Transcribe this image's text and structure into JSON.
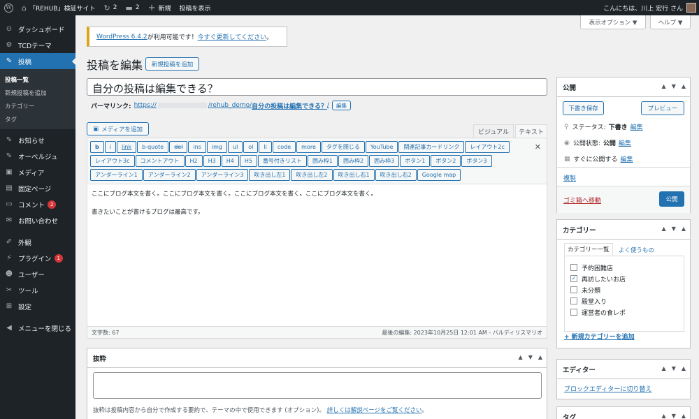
{
  "admin_bar": {
    "site_name": "「REHUB」検証サイト",
    "updates_count": "2",
    "comments_count": "2",
    "new_label": "新規",
    "view_post_label": "投稿を表示",
    "greeting": "こんにちは、川上 宏行 さん"
  },
  "sidebar": {
    "items": [
      {
        "label": "ダッシュボード",
        "icon": "dashboard-icon",
        "glyph": "⊙"
      },
      {
        "label": "TCDテーマ",
        "icon": "gear-icon",
        "glyph": "⚙"
      },
      {
        "label": "投稿",
        "icon": "pin-icon",
        "glyph": "✎"
      },
      {
        "label": "お知らせ",
        "icon": "pin-icon",
        "glyph": "✎"
      },
      {
        "label": "オーベルジュ",
        "icon": "pin-icon",
        "glyph": "✎"
      },
      {
        "label": "メディア",
        "icon": "media-icon",
        "glyph": "▣"
      },
      {
        "label": "固定ページ",
        "icon": "page-icon",
        "glyph": "▤"
      },
      {
        "label": "コメント",
        "icon": "comment-icon",
        "glyph": "▭",
        "badge": "2"
      },
      {
        "label": "お問い合わせ",
        "icon": "mail-icon",
        "glyph": "✉"
      },
      {
        "label": "外観",
        "icon": "brush-icon",
        "glyph": "✐"
      },
      {
        "label": "プラグイン",
        "icon": "plugin-icon",
        "glyph": "⚡",
        "badge": "1"
      },
      {
        "label": "ユーザー",
        "icon": "user-icon",
        "glyph": "☻"
      },
      {
        "label": "ツール",
        "icon": "wrench-icon",
        "glyph": "✂"
      },
      {
        "label": "設定",
        "icon": "settings-icon",
        "glyph": "⊞"
      },
      {
        "label": "メニューを閉じる",
        "icon": "collapse-icon",
        "glyph": "◀"
      }
    ],
    "submenu": [
      "投稿一覧",
      "新規投稿を追加",
      "カテゴリー",
      "タグ"
    ]
  },
  "top": {
    "screen_options": "表示オプション ▼",
    "help": "ヘルプ ▼"
  },
  "notice": {
    "link_version": "WordPress 6.4.2",
    "middle": " が利用可能です！",
    "link_update": "今すぐ更新してください",
    "end": "。"
  },
  "page": {
    "heading": "投稿を編集",
    "add_new": "新規投稿を追加"
  },
  "post": {
    "title": "自分の投稿は編集できる？",
    "permalink_label": "パーマリンク:",
    "permalink_base": "https://",
    "permalink_path": "/rehub_demo/",
    "permalink_slug": "自分の投稿は編集できる？",
    "permalink_end": "/",
    "edit_btn": "編集"
  },
  "editor": {
    "add_media": "メディアを追加",
    "tab_visual": "ビジュアル",
    "tab_text": "テキスト",
    "buttons": [
      "b",
      "i",
      "link",
      "b-quote",
      "del",
      "ins",
      "img",
      "ul",
      "ol",
      "li",
      "code",
      "more",
      "タグを閉じる",
      "YouTube",
      "関連記事カードリンク",
      "レイアウト2c",
      "レイアウト3c",
      "コメントアウト",
      "H2",
      "H3",
      "H4",
      "H5",
      "番号付きリスト",
      "囲み枠1",
      "囲み枠2",
      "囲み枠3",
      "ボタン1",
      "ボタン2",
      "ボタン3",
      "アンダーライン1",
      "アンダーライン2",
      "アンダーライン3",
      "吹き出し左1",
      "吹き出し左2",
      "吹き出し右1",
      "吹き出し右2",
      "Google map"
    ],
    "line1": "ここにブログ本文を書く。ここにブログ本文を書く。ここにブログ本文を書く。ここにブログ本文を書く。",
    "line2": "書きたいことが書けるブログは最高です。",
    "word_count": "文字数: 67",
    "last_edit": "最後の編集: 2023年10月25日 12:01 AM - バルディリスマリオ"
  },
  "excerpt": {
    "title": "抜粋",
    "help_text": "抜粋は投稿内容から自分で作成する要約で、テーマの中で使用できます (オプション)。",
    "help_link": "詳しくは解説ページをご覧ください",
    "help_end": "。"
  },
  "publish": {
    "title": "公開",
    "save_draft": "下書き保存",
    "preview": "プレビュー",
    "status_label": "ステータス:",
    "status_value": "下書き",
    "visibility_label": "公開状態:",
    "visibility_value": "公開",
    "schedule_text": "すぐに公開する",
    "edit": "編集",
    "duplicate": "複製",
    "trash": "ゴミ箱へ移動",
    "publish_btn": "公開"
  },
  "categories": {
    "title": "カテゴリー",
    "tab_all": "カテゴリー一覧",
    "tab_popular": "よく使うもの",
    "items": [
      {
        "label": "予約困難店",
        "checked": false
      },
      {
        "label": "再訪したいお店",
        "checked": true
      },
      {
        "label": "未分類",
        "checked": false
      },
      {
        "label": "殿堂入り",
        "checked": false
      },
      {
        "label": "運営者の食レポ",
        "checked": false
      }
    ],
    "add_new": "+ 新規カテゴリーを追加"
  },
  "editor_box": {
    "title": "エディター",
    "switch_link": "ブロックエディターに切り替え"
  },
  "tags_box": {
    "title": "タグ"
  },
  "colors": {
    "accent": "#2271b1",
    "admin_dark": "#1d2327",
    "danger": "#d63638"
  }
}
